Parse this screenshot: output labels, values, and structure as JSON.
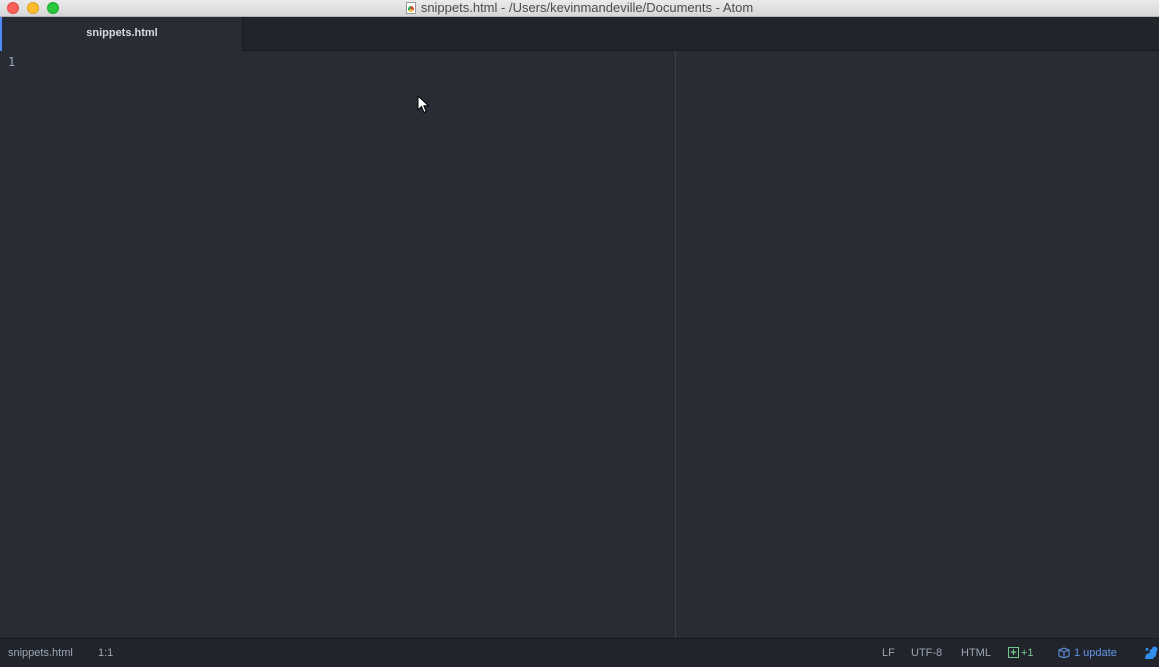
{
  "window": {
    "title": "snippets.html - /Users/kevinmandeville/Documents - Atom",
    "title_icon": "html-file-icon"
  },
  "tabs": [
    {
      "label": "snippets.html",
      "active": true
    }
  ],
  "editor": {
    "line_numbers": [
      "1"
    ],
    "content": ""
  },
  "status_bar": {
    "file": "snippets.html",
    "cursor_position": "1:1",
    "line_ending": "LF",
    "encoding": "UTF-8",
    "grammar": "HTML",
    "git_diff": "+1",
    "updates": "1 update"
  },
  "colors": {
    "editor_bg": "#282c34",
    "tab_accent": "#528bff",
    "git_added": "#73c990",
    "update_link": "#6494ed"
  }
}
